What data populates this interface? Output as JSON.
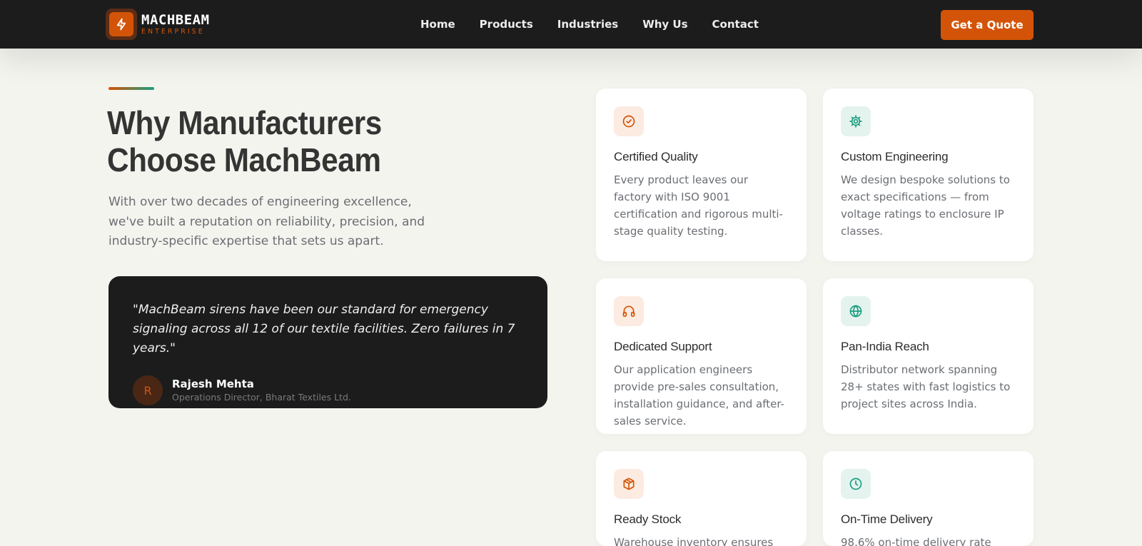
{
  "brand": {
    "name": "MACHBEAM",
    "sub": "ENTERPRISE"
  },
  "nav": {
    "links": [
      "Home",
      "Products",
      "Industries",
      "Why Us",
      "Contact"
    ],
    "cta": "Get a Quote"
  },
  "section": {
    "heading": [
      "Why Manufacturers",
      "Choose MachBeam"
    ],
    "intro": "With over two decades of engineering excellence, we've built a reputation on reliability, precision, and industry-specific expertise that sets us apart."
  },
  "testimonial": {
    "quote": "\"MachBeam sirens have been our standard for emergency signaling across all 12 of our textile facilities. Zero failures in 7 years.\"",
    "initial": "R",
    "name": "Rajesh Mehta",
    "role": "Operations Director, Bharat Textiles Ltd."
  },
  "features": [
    {
      "icon": "check-circle-icon",
      "accent": "#d35408",
      "title": "Certified Quality",
      "desc": "Every product leaves our factory with ISO 9001 certification and rigorous multi-stage quality testing."
    },
    {
      "icon": "gear-icon",
      "accent": "#1a9e7e",
      "title": "Custom Engineering",
      "desc": "We design bespoke solutions to exact specifications — from voltage ratings to enclosure IP classes."
    },
    {
      "icon": "headphones-icon",
      "accent": "#d35408",
      "title": "Dedicated Support",
      "desc": "Our application engineers provide pre-sales consultation, installation guidance, and after-sales service."
    },
    {
      "icon": "globe-icon",
      "accent": "#1a9e7e",
      "title": "Pan-India Reach",
      "desc": "Distributor network spanning 28+ states with fast logistics to project sites across India."
    },
    {
      "icon": "box-icon",
      "accent": "#d35408",
      "title": "Ready Stock",
      "desc": "Warehouse inventory ensures"
    },
    {
      "icon": "clock-icon",
      "accent": "#1a9e7e",
      "title": "On-Time Delivery",
      "desc": "98.6% on-time delivery rate"
    }
  ]
}
